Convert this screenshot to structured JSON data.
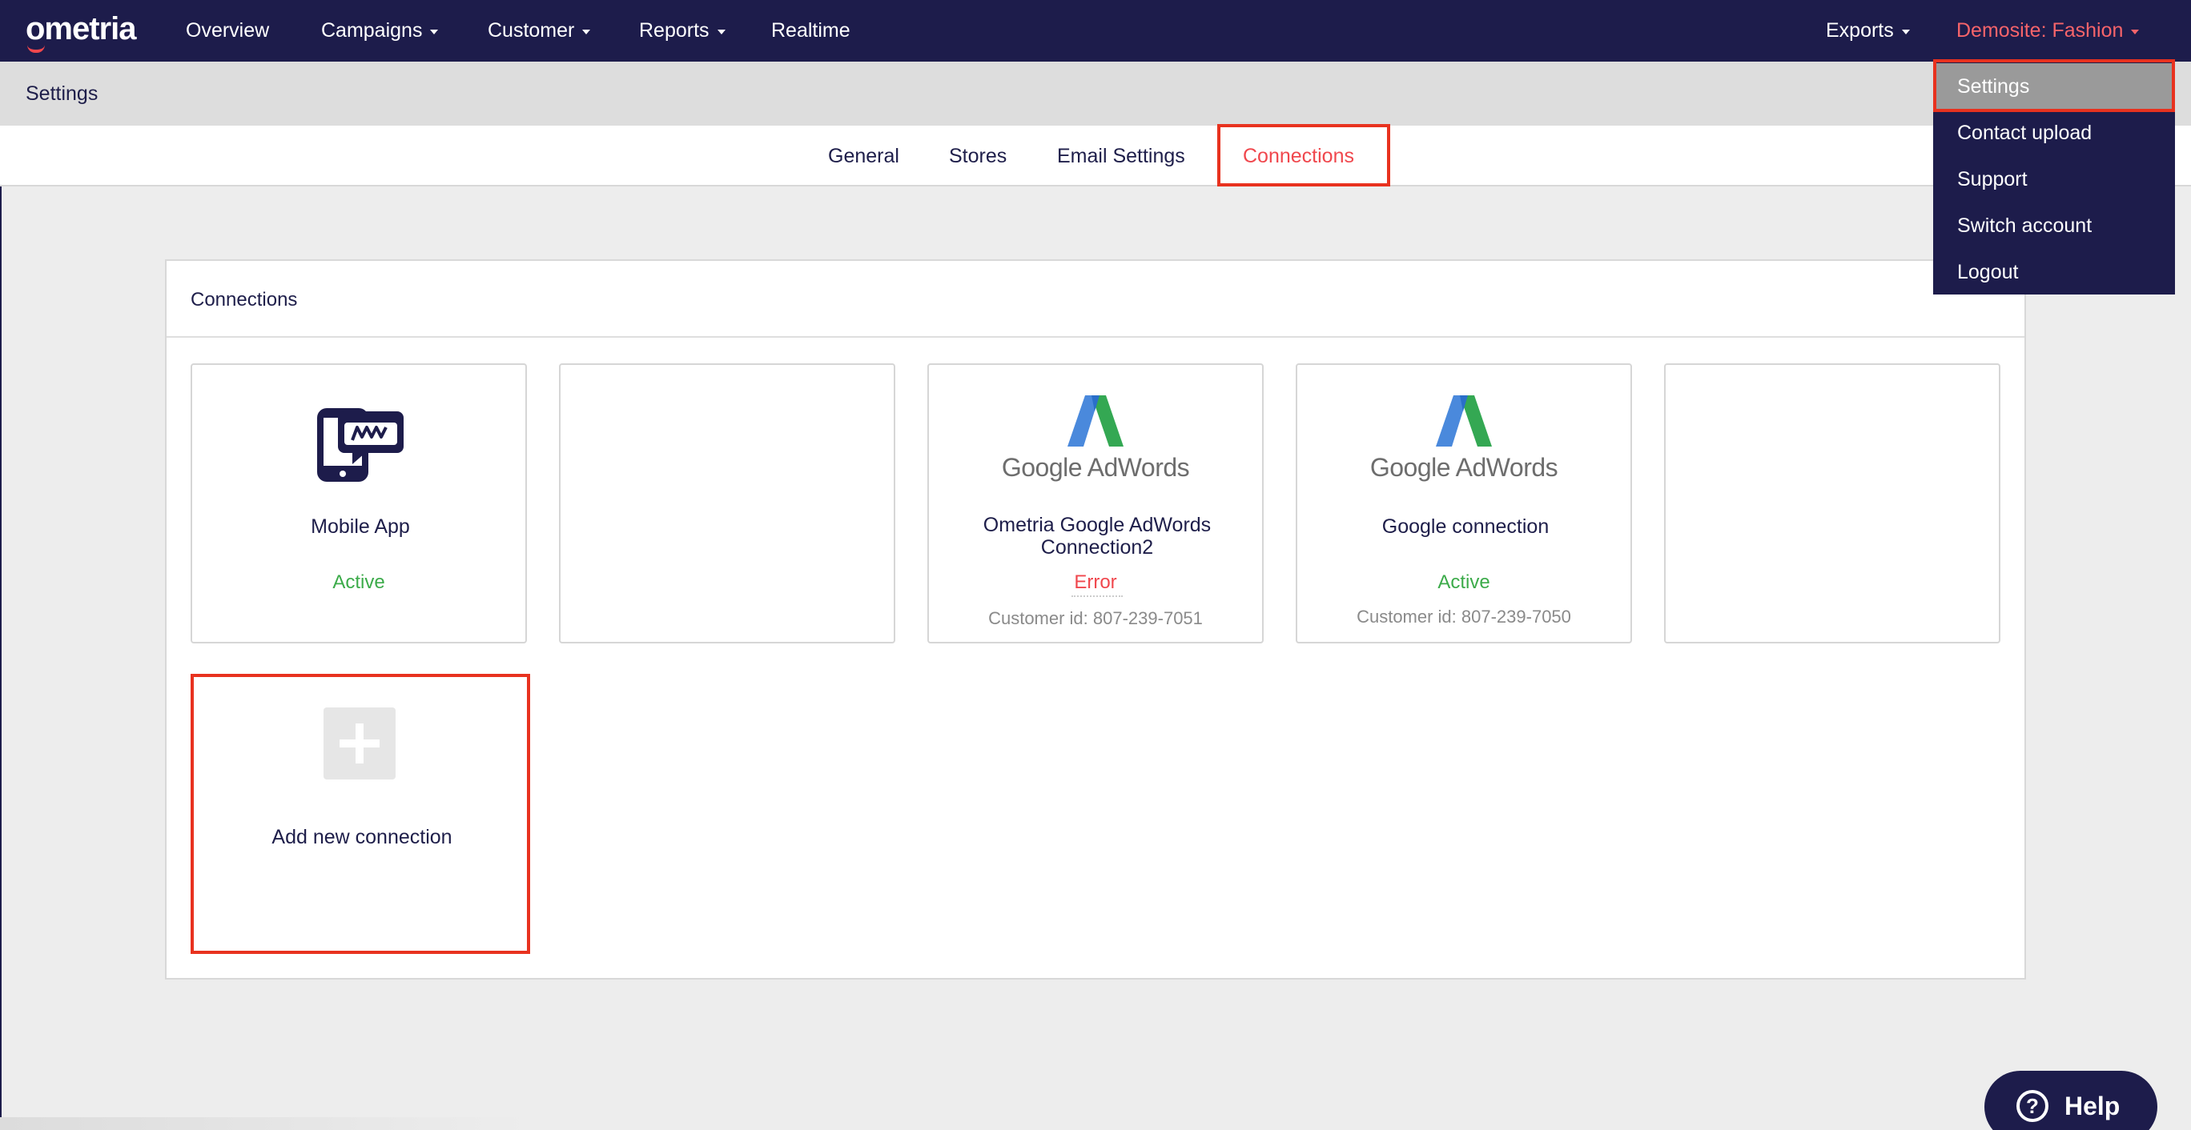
{
  "nav": {
    "logo": "ometria",
    "items": [
      {
        "label": "Overview",
        "dropdown": false
      },
      {
        "label": "Campaigns",
        "dropdown": true
      },
      {
        "label": "Customer",
        "dropdown": true
      },
      {
        "label": "Reports",
        "dropdown": true
      },
      {
        "label": "Realtime",
        "dropdown": false
      }
    ],
    "exports": "Exports",
    "account": "Demosite: Fashion"
  },
  "subbar": {
    "title": "Settings"
  },
  "tabs": [
    {
      "label": "General",
      "active": false
    },
    {
      "label": "Stores",
      "active": false
    },
    {
      "label": "Email Settings",
      "active": false
    },
    {
      "label": "Connections",
      "active": true
    }
  ],
  "panel": {
    "title": "Connections",
    "cards": [
      {
        "name": "Mobile App",
        "status": "Active",
        "icon": "mobile-app-icon"
      },
      {
        "name": "",
        "status": "",
        "icon": ""
      },
      {
        "name": "Ometria Google AdWords Connection2",
        "status": "Error",
        "customer": "Customer id: 807-239-7051",
        "icon": "google-adwords-logo",
        "logo_text": "Google AdWords"
      },
      {
        "name": "Google connection",
        "status": "Active",
        "customer": "Customer id: 807-239-7050",
        "icon": "google-adwords-logo",
        "logo_text": "Google AdWords"
      },
      {
        "name": "",
        "status": "",
        "icon": ""
      }
    ],
    "add": {
      "label": "Add new connection",
      "icon": "plus-icon"
    }
  },
  "dropdown": {
    "items": [
      "Settings",
      "Contact upload",
      "Support",
      "Switch account",
      "Logout"
    ],
    "active": "Settings"
  },
  "help": {
    "label": "Help",
    "icon": "question-icon"
  },
  "colors": {
    "navy": "#1d1c4b",
    "accent_red": "#f0474d",
    "active_green": "#3cab4a",
    "highlight_red": "#e8321f"
  }
}
